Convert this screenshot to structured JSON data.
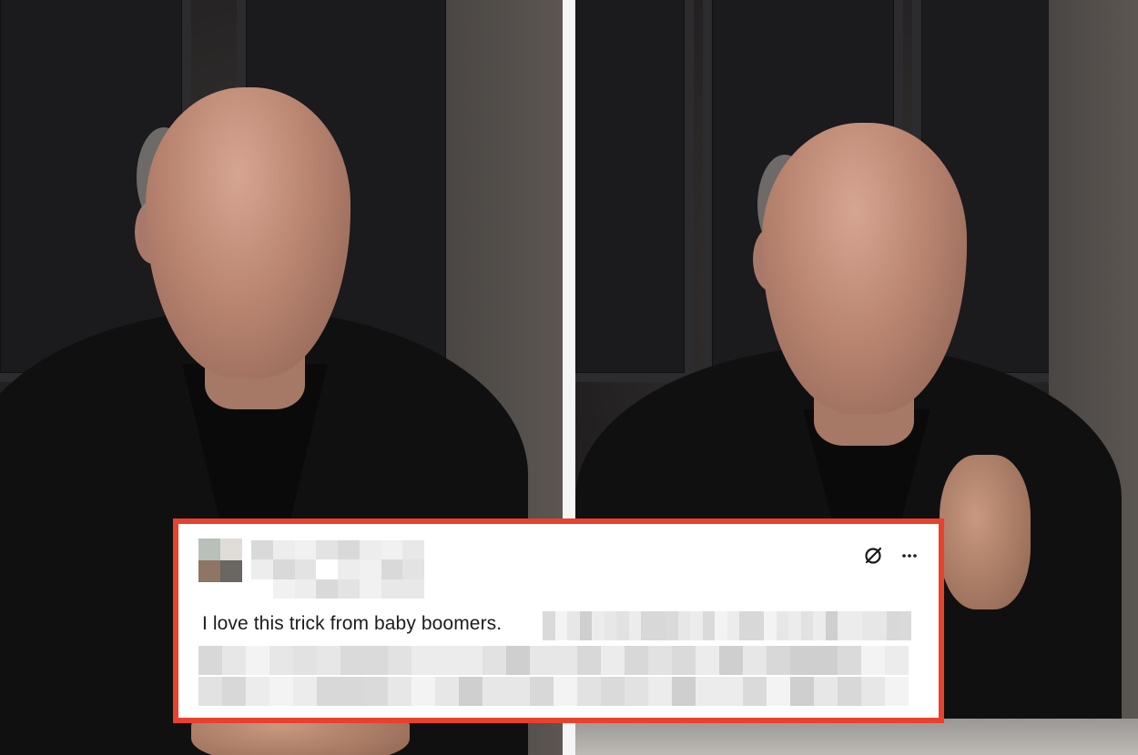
{
  "post": {
    "text": "I love this trick from baby boomers.",
    "icons": [
      "no-entry-icon",
      "more-options-icon"
    ],
    "border_color": "#e8412e"
  },
  "layout_colors": {
    "divider": "#f4f4f4",
    "card_background": "#ffffff"
  }
}
